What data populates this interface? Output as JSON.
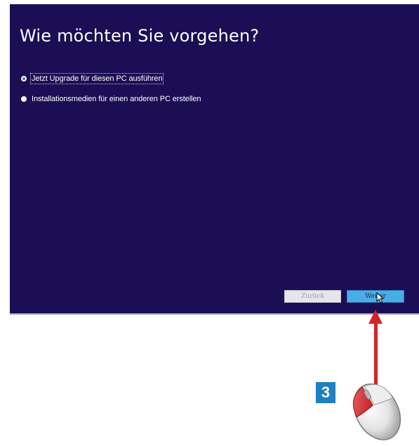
{
  "dialog": {
    "heading": "Wie möchten Sie vorgehen?",
    "options": [
      {
        "label": "Jetzt Upgrade für diesen PC ausführen",
        "selected": true
      },
      {
        "label": "Installationsmedien für einen anderen PC erstellen",
        "selected": false
      }
    ],
    "buttons": {
      "back_label": "Zurück",
      "next_label": "Weiter"
    },
    "background_color": "#1b0e55"
  },
  "annotation": {
    "step_number": "3",
    "arrow_color": "#d1232a",
    "badge_color": "#1f7fc0"
  }
}
